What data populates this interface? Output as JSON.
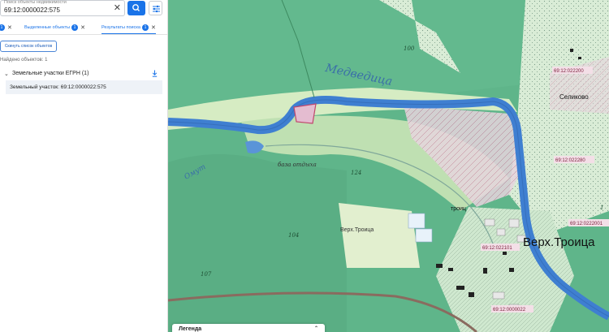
{
  "search": {
    "label": "Поиск объекты недвижимости",
    "value": "69:12:0000022:575"
  },
  "tabs": [
    {
      "label": "",
      "count": "1"
    },
    {
      "label": "Выделенные объекты",
      "count": "1"
    },
    {
      "label": "Результаты поиска",
      "count": "1"
    }
  ],
  "reset_label": "Скинуть список объектов",
  "found_text": "Найдено объектов: 1",
  "group": {
    "label": "Земельные участки ЕГРН (1)"
  },
  "result_item": "Земельный участок: 69:12:0000022:575",
  "map": {
    "labels": {
      "river": "Медведица",
      "lake": "Омут",
      "base": "база отдыха",
      "verh_troitsa_small": "Верх.Троица",
      "verh_troitsa_big": "Верх.Троица",
      "selikovo": "Селиково",
      "troitsa": "троиц",
      "e100": "100",
      "e124": "124",
      "e104": "104",
      "e107": "107",
      "e1": "1"
    },
    "cadastral": [
      "69:12:022200",
      "69:12:022280",
      "69:12:022101",
      "69:12:0000022",
      "69:12:0222001"
    ]
  },
  "legend": {
    "title": "Легенда"
  },
  "colors": {
    "accent": "#1a73e8",
    "forest": "#5fb58a",
    "forest_dark": "#3f9a6d",
    "meadow": "#d6ecc3",
    "water": "#3f7fd1",
    "parcel_border": "#c0466b"
  }
}
